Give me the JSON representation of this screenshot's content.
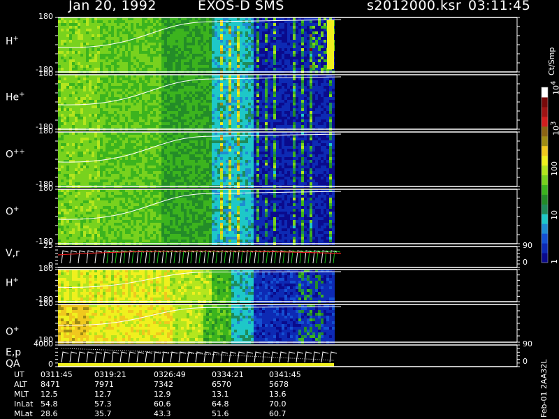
{
  "header": {
    "date": "Jan 20, 1992",
    "instrument": "EXOS-D SMS",
    "filename": "s2012000.ksr",
    "time": "03:11:45"
  },
  "colorbar": {
    "label": "Ct/Smp",
    "ticks": [
      {
        "text": "1",
        "sup": "",
        "value": 1
      },
      {
        "text": "10",
        "sup": "",
        "value": 10
      },
      {
        "text": "100",
        "sup": "",
        "value": 100
      },
      {
        "text": "10",
        "sup": "3",
        "value": 1000
      },
      {
        "text": "10",
        "sup": "4",
        "value": 10000
      }
    ],
    "colors": [
      "#0a0a8c",
      "#0d2ab4",
      "#1450d2",
      "#1e8cd2",
      "#1ec8c8",
      "#1e8c5a",
      "#238c28",
      "#3cb41e",
      "#78d21e",
      "#b4e61e",
      "#f0f01e",
      "#f0c81e",
      "#a08c14",
      "#8c6414",
      "#d21e1e",
      "#a01414",
      "#780a0a",
      "#ffffff"
    ]
  },
  "panels": [
    {
      "label": "H",
      "sup": "+",
      "ymax": "180",
      "ymin": "-180"
    },
    {
      "label": "He",
      "sup": "+",
      "ymax": "180",
      "ymin": "-180"
    },
    {
      "label": "O",
      "sup": "++",
      "ymax": "180",
      "ymin": "-180"
    },
    {
      "label": "O",
      "sup": "+",
      "ymax": "180",
      "ymin": "-180"
    },
    {
      "label": "V,r",
      "sup": "",
      "ymax": "25",
      "ymin": "0",
      "rmax": "90",
      "rmin": "0"
    },
    {
      "label": "H",
      "sup": "+",
      "ymax": "180",
      "ymin": "-180"
    },
    {
      "label": "O",
      "sup": "+",
      "ymax": "180",
      "ymin": "-180"
    },
    {
      "label": "E,p",
      "sup": "",
      "label2": "QA",
      "ymax": "4000",
      "ymin": "0",
      "rmax": "90",
      "rmin": "0"
    }
  ],
  "footer": {
    "version": "Feb-01 2AA32L",
    "rows": [
      {
        "name": "UT",
        "values": [
          "0311:45",
          "0319:21",
          "0326:49",
          "0334:21",
          "0341:45"
        ]
      },
      {
        "name": "ALT",
        "values": [
          "8471",
          "7971",
          "7342",
          "6570",
          "5678"
        ]
      },
      {
        "name": "MLT",
        "values": [
          "12.5",
          "12.7",
          "12.9",
          "13.1",
          "13.6"
        ]
      },
      {
        "name": "InLat",
        "values": [
          "54.8",
          "57.3",
          "60.6",
          "64.8",
          "70.0"
        ]
      },
      {
        "name": "MLat",
        "values": [
          "28.6",
          "35.7",
          "43.3",
          "51.6",
          "60.7"
        ]
      }
    ]
  },
  "chart_data": {
    "type": "heatmap",
    "x_ticks_ut": [
      "0311:45",
      "0319:21",
      "0326:49",
      "0334:21",
      "0341:45"
    ],
    "panels": [
      {
        "species": "H+",
        "y_range": [
          -180,
          180
        ]
      },
      {
        "species": "He+",
        "y_range": [
          -180,
          180
        ]
      },
      {
        "species": "O++",
        "y_range": [
          -180,
          180
        ]
      },
      {
        "species": "O+",
        "y_range": [
          -180,
          180
        ]
      },
      {
        "species": "V,r",
        "y_range": [
          0,
          25
        ],
        "y2_range": [
          0,
          90
        ]
      },
      {
        "species": "H+",
        "y_range": [
          -180,
          180
        ]
      },
      {
        "species": "O+",
        "y_range": [
          -180,
          180
        ]
      },
      {
        "species": "E,p / QA",
        "y_range": [
          0,
          4000
        ],
        "y2_range": [
          0,
          90
        ]
      }
    ],
    "color_scale": {
      "label": "Ct/Smp",
      "scale": "log",
      "range": [
        1,
        10000
      ]
    }
  }
}
